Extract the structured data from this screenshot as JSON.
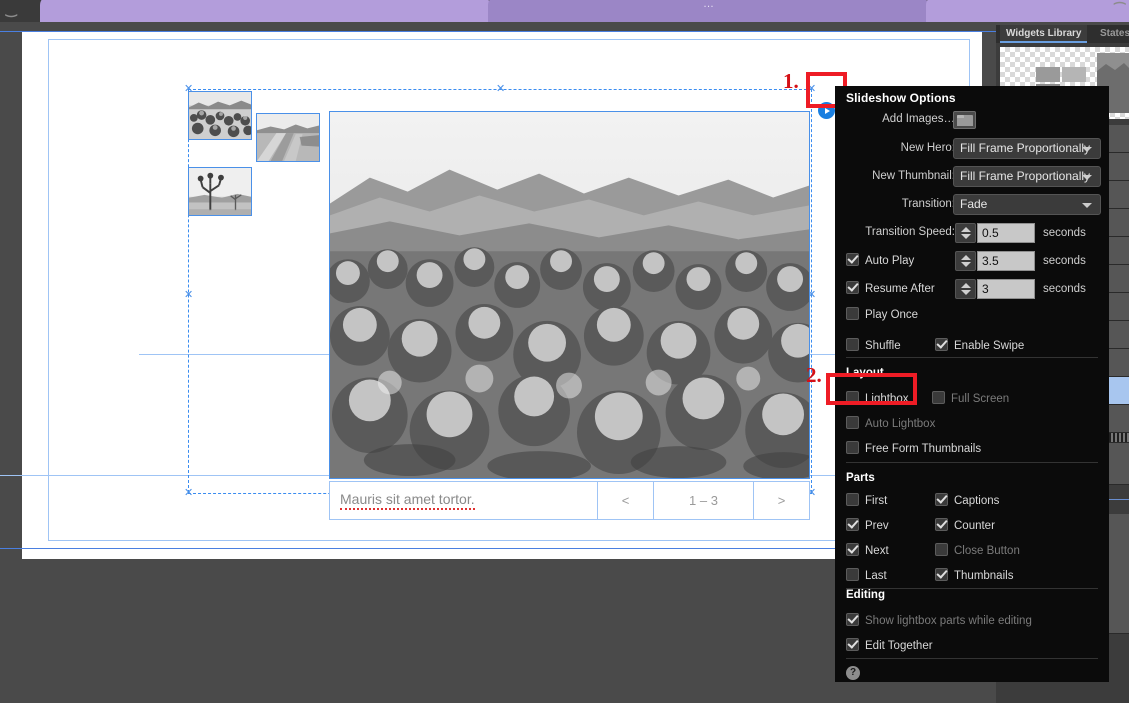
{
  "app": {
    "dock": {
      "tabs": [
        {
          "label": "Widgets Library",
          "active": true
        },
        {
          "label": "States",
          "active": false
        }
      ]
    }
  },
  "canvas": {
    "caption_text": "Mauris sit amet tortor.",
    "nav": {
      "prev_label": "<",
      "counter_label": "1 – 3",
      "next_label": ">"
    }
  },
  "markers": {
    "one": "1.",
    "two": "2.",
    "play_icon": "play-circle-icon"
  },
  "panel": {
    "title": "Slideshow Options",
    "add_images": {
      "label": "Add Images…",
      "button_icon": "folder-icon"
    },
    "fields": [
      {
        "label": "New Hero:",
        "value": "Fill Frame Proportionally"
      },
      {
        "label": "New Thumbnail:",
        "value": "Fill Frame Proportionally"
      },
      {
        "label": "Transition:",
        "value": "Fade"
      }
    ],
    "steppers": [
      {
        "label": "Transition Speed:",
        "value": "0.5",
        "unit": "seconds",
        "checkbox": null
      },
      {
        "label": "Auto Play",
        "value": "3.5",
        "unit": "seconds",
        "checkbox": true
      },
      {
        "label": "Resume After",
        "value": "3",
        "unit": "seconds",
        "checkbox": true
      }
    ],
    "play_once": {
      "label": "Play Once",
      "checked": false
    },
    "shuffle": {
      "label": "Shuffle",
      "checked": false
    },
    "enable_swipe": {
      "label": "Enable Swipe",
      "checked": true
    },
    "sections": {
      "layout": "Layout",
      "parts": "Parts",
      "editing": "Editing"
    },
    "layout_options": [
      {
        "label": "Lightbox",
        "checked": false,
        "disabled": false
      },
      {
        "label": "Full Screen",
        "checked": false,
        "disabled": true
      },
      {
        "label": "Auto Lightbox",
        "checked": false,
        "disabled": true
      },
      {
        "label": "Free Form Thumbnails",
        "checked": false,
        "disabled": false
      }
    ],
    "parts_left": [
      {
        "label": "First",
        "checked": false,
        "disabled": false
      },
      {
        "label": "Prev",
        "checked": true,
        "disabled": false
      },
      {
        "label": "Next",
        "checked": true,
        "disabled": false
      },
      {
        "label": "Last",
        "checked": false,
        "disabled": false
      }
    ],
    "parts_right": [
      {
        "label": "Captions",
        "checked": true,
        "disabled": false
      },
      {
        "label": "Counter",
        "checked": true,
        "disabled": false
      },
      {
        "label": "Close Button",
        "checked": false,
        "disabled": true
      },
      {
        "label": "Thumbnails",
        "checked": true,
        "disabled": false
      }
    ],
    "editing_options": [
      {
        "label": "Show lightbox parts while editing",
        "checked": true,
        "disabled": true
      },
      {
        "label": "Edit Together",
        "checked": true,
        "disabled": false
      }
    ],
    "help_label": "?"
  },
  "colors": {
    "panel_bg": "#0b0b0b",
    "accent_blue": "#4a90e8",
    "marker_red": "#ee1c25",
    "lavender": "#b39ddb",
    "workspace": "#4a4a4a"
  }
}
